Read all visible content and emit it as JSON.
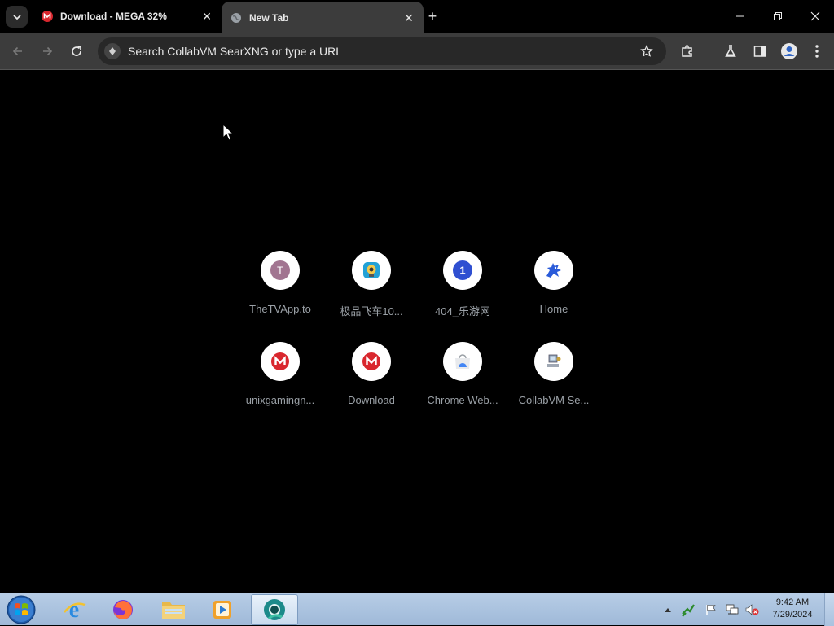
{
  "browser": {
    "tabs": [
      {
        "title": "Download - MEGA 32%",
        "icon": "mega-icon",
        "active": false
      },
      {
        "title": "New Tab",
        "icon": "globe-icon",
        "active": true
      }
    ],
    "omnibox": {
      "placeholder": "Search CollabVM SearXNG or type a URL",
      "value": ""
    }
  },
  "shortcuts": [
    {
      "label": "TheTVApp.to",
      "icon": "letter-t-icon",
      "letter": "T",
      "color": "#a27591"
    },
    {
      "label": "极品飞车10...",
      "icon": "webcam-icon",
      "color": "#22a1d6"
    },
    {
      "label": "404_乐游网",
      "icon": "number-one-icon",
      "letter": "1",
      "color": "#2f4fd1"
    },
    {
      "label": "Home",
      "icon": "dragon-icon",
      "color": "#2a5bd9"
    },
    {
      "label": "unixgamingn...",
      "icon": "mega-icon",
      "letter": "M",
      "color": "#d9272e"
    },
    {
      "label": "Download",
      "icon": "mega-icon",
      "letter": "M",
      "color": "#d9272e"
    },
    {
      "label": "Chrome Web...",
      "icon": "chrome-webstore-icon",
      "color": "#4285f4"
    },
    {
      "label": "CollabVM Se...",
      "icon": "computer-icon",
      "color": "#6d7a8a"
    }
  ],
  "taskbar": {
    "apps": [
      "internet-explorer-icon",
      "firefox-icon",
      "file-explorer-icon",
      "media-player-icon",
      "chrome-canary-icon"
    ],
    "clock": {
      "time": "9:42 AM",
      "date": "7/29/2024"
    }
  }
}
